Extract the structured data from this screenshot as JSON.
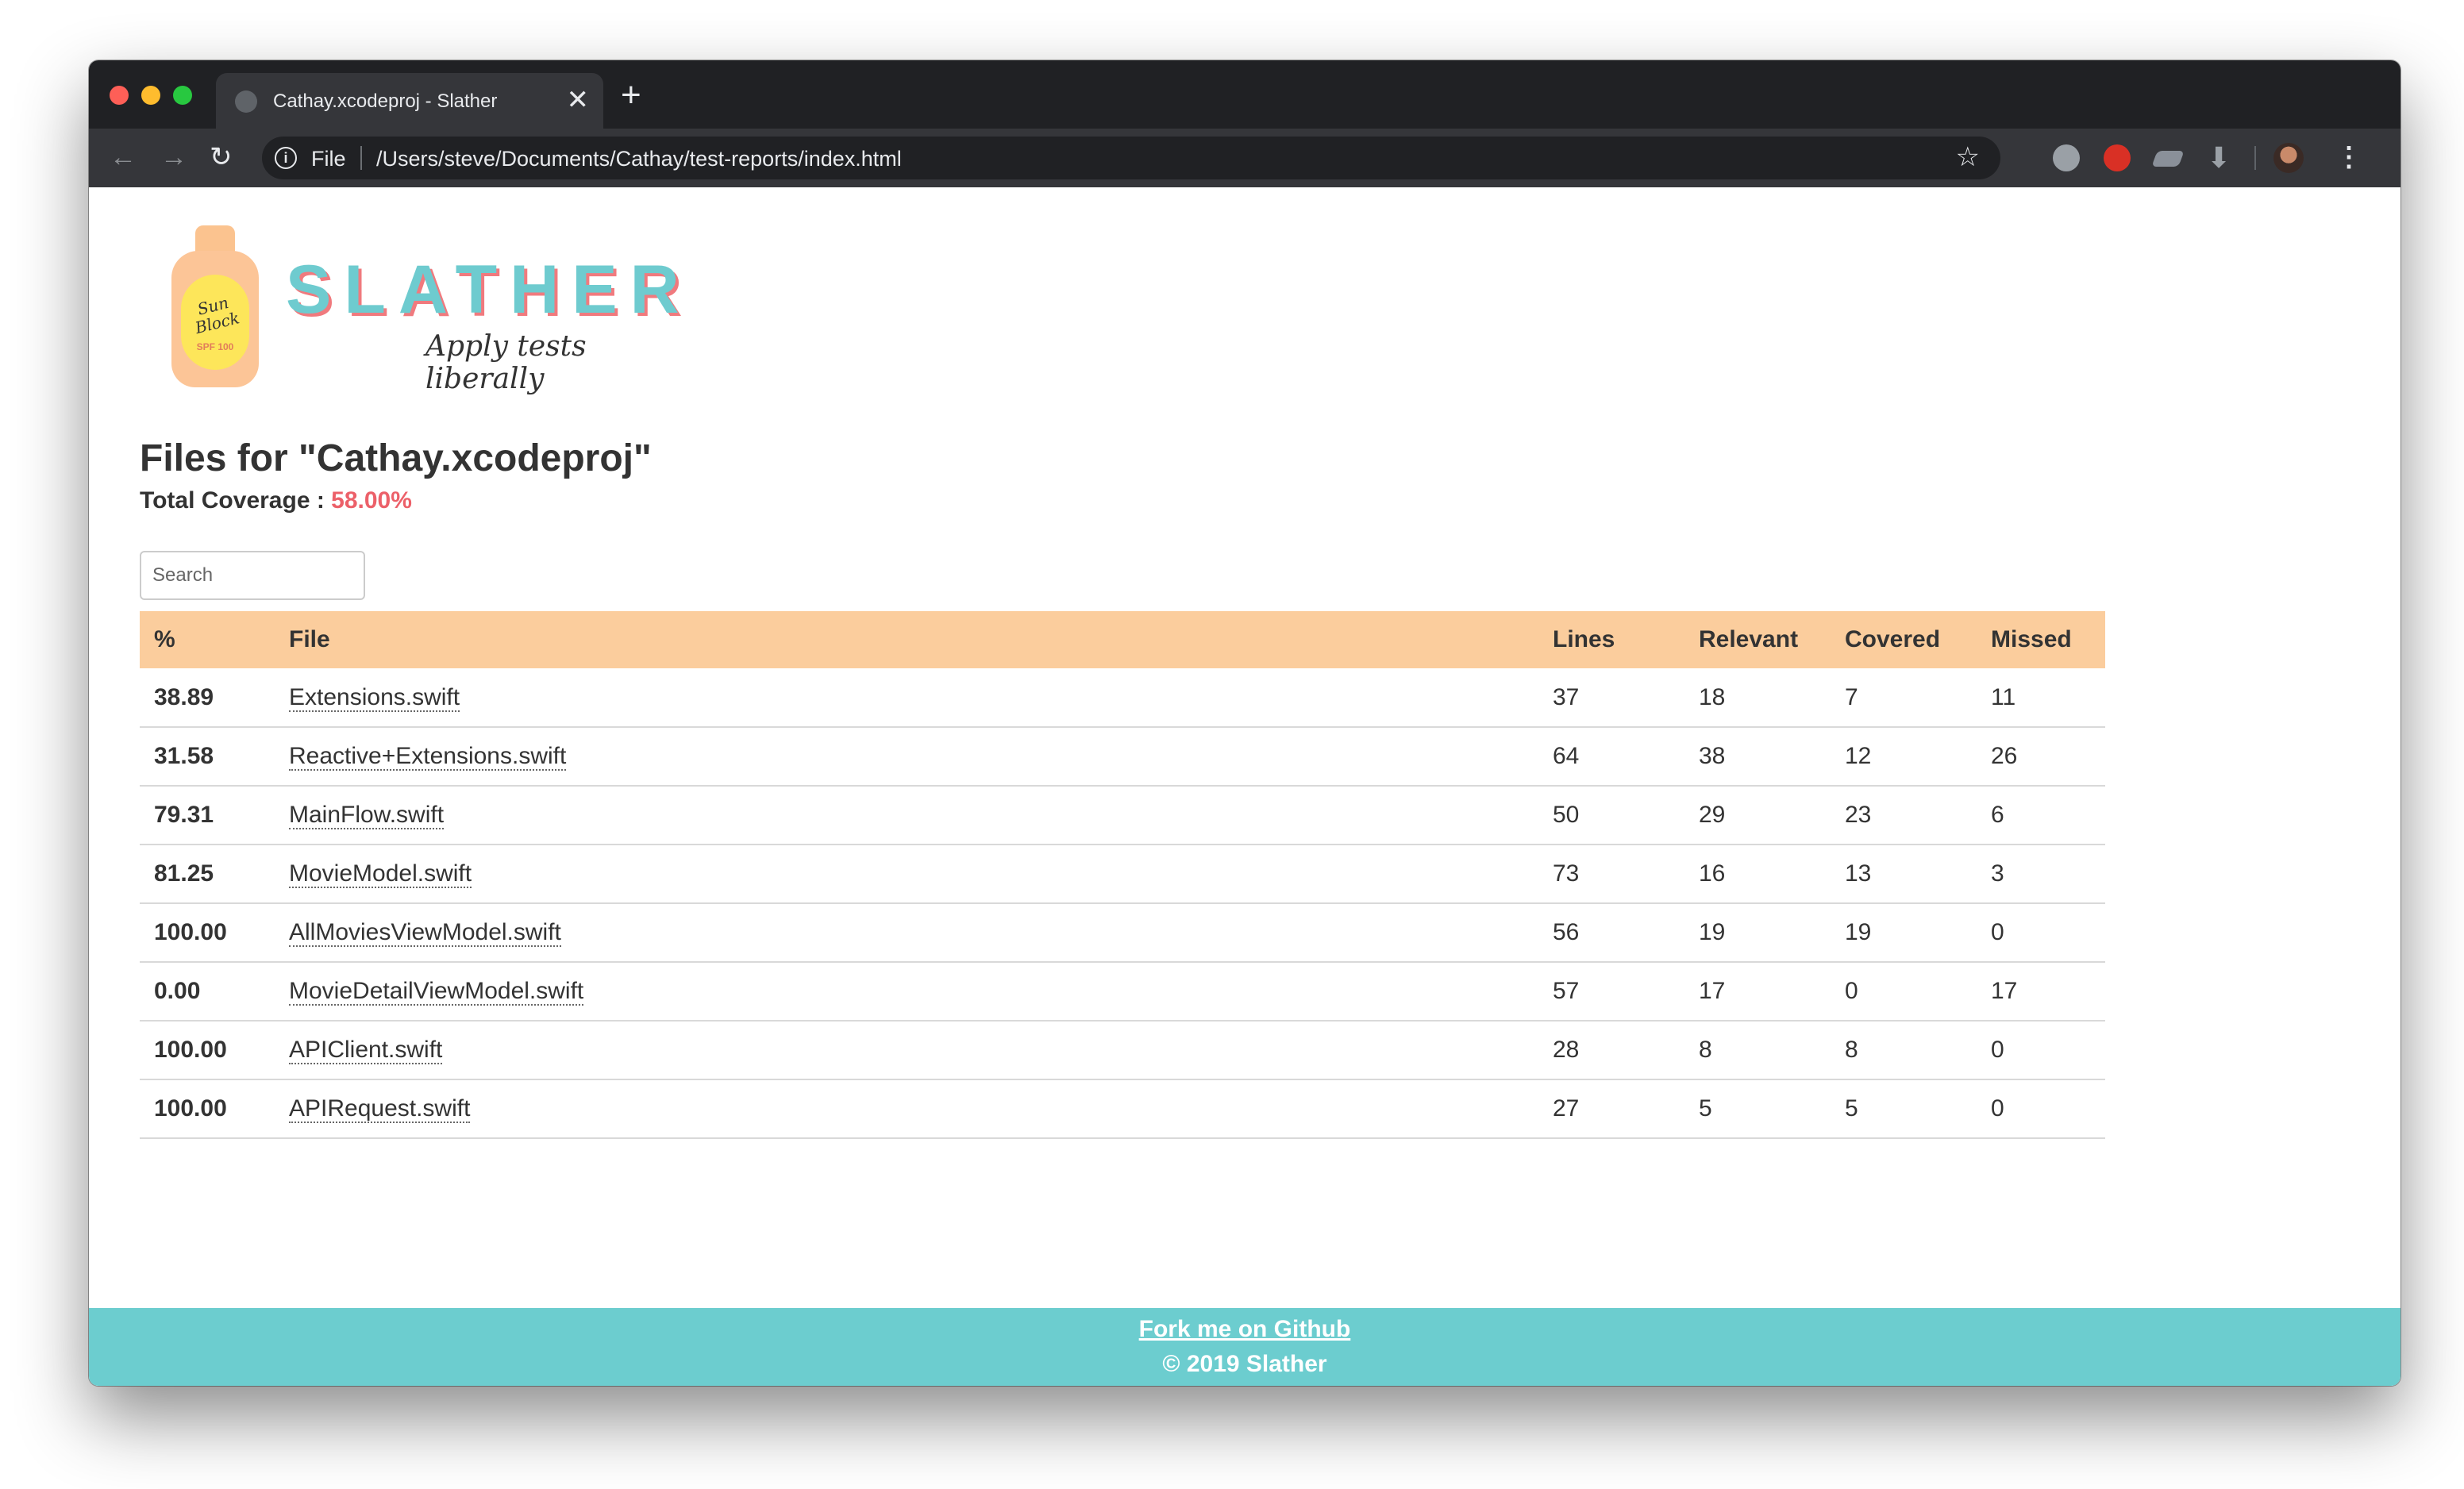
{
  "browser": {
    "tab_title": "Cathay.xcodeproj - Slather",
    "tab_close": "✕",
    "new_tab": "+",
    "scheme_label": "File",
    "url": "/Users/steve/Documents/Cathay/test-reports/index.html"
  },
  "logo": {
    "brand": "SLATHER",
    "tagline": "Apply tests liberally",
    "bottle_text": "Sun Block",
    "bottle_spf": "SPF 100"
  },
  "page": {
    "title": "Files for \"Cathay.xcodeproj\"",
    "coverage_label": "Total Coverage : ",
    "coverage_value": "58.00%"
  },
  "search": {
    "placeholder": "Search"
  },
  "table": {
    "headers": {
      "pct": "%",
      "file": "File",
      "lines": "Lines",
      "relevant": "Relevant",
      "covered": "Covered",
      "missed": "Missed"
    },
    "rows": [
      {
        "pct": "38.89",
        "file": "Extensions.swift",
        "lines": "37",
        "relevant": "18",
        "covered": "7",
        "missed": "11",
        "level": "low"
      },
      {
        "pct": "31.58",
        "file": "Reactive+Extensions.swift",
        "lines": "64",
        "relevant": "38",
        "covered": "12",
        "missed": "26",
        "level": "low"
      },
      {
        "pct": "79.31",
        "file": "MainFlow.swift",
        "lines": "50",
        "relevant": "29",
        "covered": "23",
        "missed": "6",
        "level": "mid"
      },
      {
        "pct": "81.25",
        "file": "MovieModel.swift",
        "lines": "73",
        "relevant": "16",
        "covered": "13",
        "missed": "3",
        "level": "mid"
      },
      {
        "pct": "100.00",
        "file": "AllMoviesViewModel.swift",
        "lines": "56",
        "relevant": "19",
        "covered": "19",
        "missed": "0",
        "level": "high"
      },
      {
        "pct": "0.00",
        "file": "MovieDetailViewModel.swift",
        "lines": "57",
        "relevant": "17",
        "covered": "0",
        "missed": "17",
        "level": "low"
      },
      {
        "pct": "100.00",
        "file": "APIClient.swift",
        "lines": "28",
        "relevant": "8",
        "covered": "8",
        "missed": "0",
        "level": "high"
      },
      {
        "pct": "100.00",
        "file": "APIRequest.swift",
        "lines": "27",
        "relevant": "5",
        "covered": "5",
        "missed": "0",
        "level": "high"
      }
    ]
  },
  "footer": {
    "fork_link": "Fork me on Github",
    "copyright": "© 2019 Slather"
  },
  "colors": {
    "header_bg": "#fbcd9d",
    "footer_bg": "#6ccdcf",
    "low": "#ec6069",
    "mid": "#f0932b",
    "high": "#4fc36e"
  }
}
